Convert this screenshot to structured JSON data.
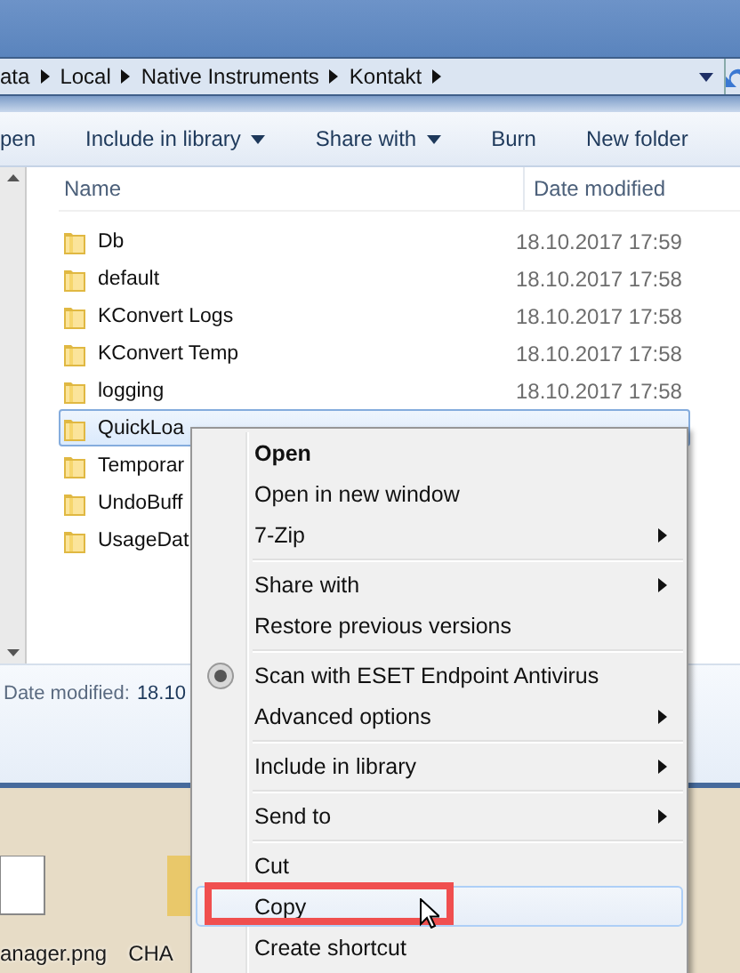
{
  "address_bar": {
    "crumbs": [
      "ata",
      "Local",
      "Native Instruments",
      "Kontakt"
    ]
  },
  "toolbar": {
    "buttons": [
      {
        "label": "pen",
        "dropdown": false
      },
      {
        "label": "Include in library",
        "dropdown": true
      },
      {
        "label": "Share with",
        "dropdown": true
      },
      {
        "label": "Burn",
        "dropdown": false
      },
      {
        "label": "New folder",
        "dropdown": false
      }
    ]
  },
  "file_list": {
    "columns": [
      "Name",
      "Date modified"
    ],
    "rows": [
      {
        "name": "Db",
        "date": "18.10.2017 17:59",
        "selected": false
      },
      {
        "name": "default",
        "date": "18.10.2017 17:58",
        "selected": false
      },
      {
        "name": "KConvert Logs",
        "date": "18.10.2017 17:58",
        "selected": false
      },
      {
        "name": "KConvert Temp",
        "date": "18.10.2017 17:58",
        "selected": false
      },
      {
        "name": "logging",
        "date": "18.10.2017 17:58",
        "selected": false
      },
      {
        "name": "QuickLoa",
        "selected": true
      },
      {
        "name": "Temporar",
        "selected": false
      },
      {
        "name": "UndoBuff",
        "selected": false
      },
      {
        "name": "UsageDat",
        "selected": false
      }
    ]
  },
  "details_pane": {
    "label": "Date modified:",
    "value": "18.10"
  },
  "desktop": {
    "icons": [
      {
        "label": "anager.png",
        "kind": "document"
      },
      {
        "label": "CHA",
        "kind": "folder"
      }
    ]
  },
  "context_menu": {
    "groups": [
      [
        {
          "label": "Open",
          "default": true,
          "submenu": false,
          "icon": false,
          "highlighted": false,
          "annotated": false
        },
        {
          "label": "Open in new window",
          "default": false,
          "submenu": false,
          "icon": false,
          "highlighted": false,
          "annotated": false
        },
        {
          "label": "7-Zip",
          "default": false,
          "submenu": true,
          "icon": false,
          "highlighted": false,
          "annotated": false
        }
      ],
      [
        {
          "label": "Share with",
          "default": false,
          "submenu": true,
          "icon": false,
          "highlighted": false,
          "annotated": false
        },
        {
          "label": "Restore previous versions",
          "default": false,
          "submenu": false,
          "icon": false,
          "highlighted": false,
          "annotated": false
        }
      ],
      [
        {
          "label": "Scan with ESET Endpoint Antivirus",
          "default": false,
          "submenu": false,
          "icon": true,
          "highlighted": false,
          "annotated": false
        },
        {
          "label": "Advanced options",
          "default": false,
          "submenu": true,
          "icon": false,
          "highlighted": false,
          "annotated": false
        }
      ],
      [
        {
          "label": "Include in library",
          "default": false,
          "submenu": true,
          "icon": false,
          "highlighted": false,
          "annotated": false
        }
      ],
      [
        {
          "label": "Send to",
          "default": false,
          "submenu": true,
          "icon": false,
          "highlighted": false,
          "annotated": false
        }
      ],
      [
        {
          "label": "Cut",
          "default": false,
          "submenu": false,
          "icon": false,
          "highlighted": false,
          "annotated": false
        },
        {
          "label": "Copy",
          "default": false,
          "submenu": false,
          "icon": false,
          "highlighted": true,
          "annotated": true
        },
        {
          "label": "Create shortcut",
          "default": false,
          "submenu": false,
          "icon": false,
          "highlighted": false,
          "annotated": false
        }
      ]
    ]
  }
}
